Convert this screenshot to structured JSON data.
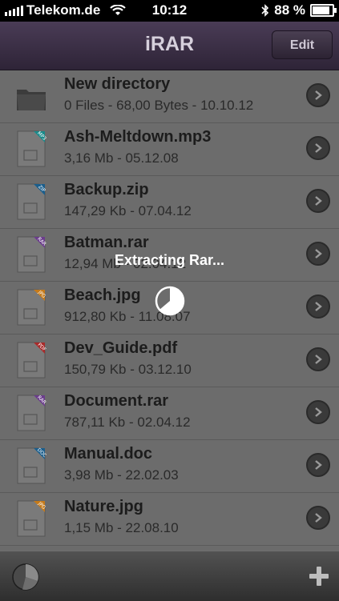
{
  "status": {
    "carrier": "Telekom.de",
    "time": "10:12",
    "battery": "88 %"
  },
  "nav": {
    "title": "iRAR",
    "edit_label": "Edit"
  },
  "files": [
    {
      "name": "New directory",
      "meta": "0 Files - 68,00 Bytes - 10.10.12",
      "type": "folder",
      "badge": "",
      "color": "#3a3a3a"
    },
    {
      "name": "Ash-Meltdown.mp3",
      "meta": "3,16 Mb - 05.12.08",
      "type": "mp3",
      "badge": "MP3",
      "color": "#1a8a8a"
    },
    {
      "name": "Backup.zip",
      "meta": "147,29 Kb - 07.04.12",
      "type": "zip",
      "badge": "ZIP",
      "color": "#1b5e8c"
    },
    {
      "name": "Batman.rar",
      "meta": "12,94 Mb - 02.04.12",
      "type": "rar",
      "badge": "RAR",
      "color": "#6b3d8c"
    },
    {
      "name": "Beach.jpg",
      "meta": "912,80 Kb - 11.08.07",
      "type": "jpg",
      "badge": "JPG",
      "color": "#c57a1a"
    },
    {
      "name": "Dev_Guide.pdf",
      "meta": "150,79 Kb - 03.12.10",
      "type": "pdf",
      "badge": "PDF",
      "color": "#a82a2a"
    },
    {
      "name": "Document.rar",
      "meta": "787,11 Kb - 02.04.12",
      "type": "rar",
      "badge": "RAR",
      "color": "#6b3d8c"
    },
    {
      "name": "Manual.doc",
      "meta": "3,98 Mb - 22.02.03",
      "type": "doc",
      "badge": "DOC",
      "color": "#1b5e8c"
    },
    {
      "name": "Nature.jpg",
      "meta": "1,15 Mb - 22.08.10",
      "type": "jpg",
      "badge": "JPG",
      "color": "#c57a1a"
    }
  ],
  "overlay": {
    "message": "Extracting Rar..."
  },
  "toolbar": {
    "left_icon": "pie-chart-icon",
    "right_icon": "plus-icon"
  }
}
